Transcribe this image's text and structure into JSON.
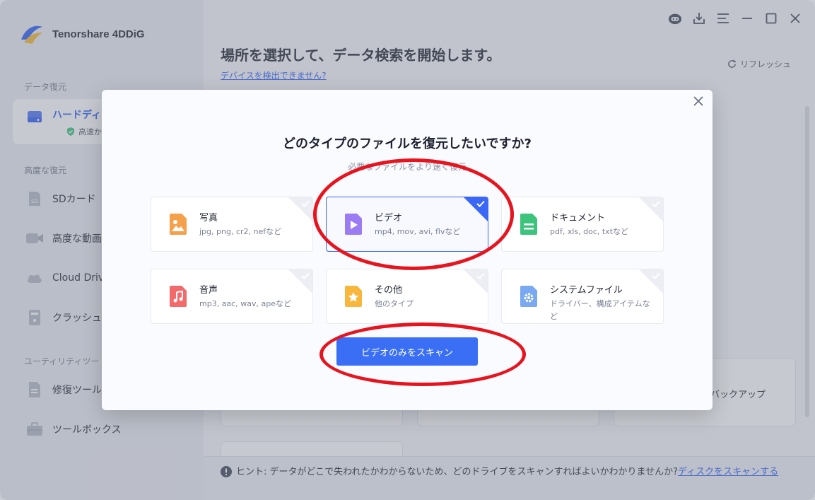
{
  "app": {
    "name": "Tenorshare 4DDiG"
  },
  "sidebar": {
    "sections": {
      "data_recovery": "データ復元",
      "advanced_recovery": "高度な復元",
      "utility_tools": "ユーティリティツー"
    },
    "items": [
      {
        "label": "ハードディ",
        "sub": "高速かつ"
      },
      {
        "label": "SDカード"
      },
      {
        "label": "高度な動画"
      },
      {
        "label": "Cloud Driv"
      },
      {
        "label": "クラッシュ"
      },
      {
        "label": "修復ツール"
      },
      {
        "label": "ツールボックス"
      }
    ]
  },
  "main": {
    "heading": "場所を選択して、データ検索を開始します。",
    "detect_link": "デバイスを検出できません?",
    "refresh": "リフレッシュ",
    "backup_label": "バックアップ"
  },
  "hint": {
    "prefix": "ヒント:",
    "text": "データがどこで失われたかわからないため、どのドライブをスキャンすればよいかわかりませんか?",
    "link": "ディスクをスキャンする"
  },
  "modal": {
    "title": "どのタイプのファイルを復元したいですか?",
    "subtitle": "必要なファイルをより速く復元",
    "scan_button": "ビデオのみをスキャン",
    "file_types": [
      {
        "name": "写真",
        "desc": "jpg, png, cr2, nefなど",
        "selected": false
      },
      {
        "name": "ビデオ",
        "desc": "mp4, mov, avi, flvなど",
        "selected": true
      },
      {
        "name": "ドキュメント",
        "desc": "pdf, xls, doc, txtなど",
        "selected": false
      },
      {
        "name": "音声",
        "desc": "mp3, aac, wav, apeなど",
        "selected": false
      },
      {
        "name": "その他",
        "desc": "他のタイプ",
        "selected": false
      },
      {
        "name": "システムファイル",
        "desc": "ドライバー、構成アイテムなど",
        "selected": false
      }
    ]
  },
  "colors": {
    "accent": "#3a6ff5",
    "annotation": "#e6141e",
    "photo_icon": "#f5a04a",
    "video_icon": "#9b7cf2",
    "document_icon": "#3cc47c",
    "audio_icon": "#f26a6a",
    "other_icon": "#f6b73c",
    "system_icon": "#7aa9f2"
  }
}
